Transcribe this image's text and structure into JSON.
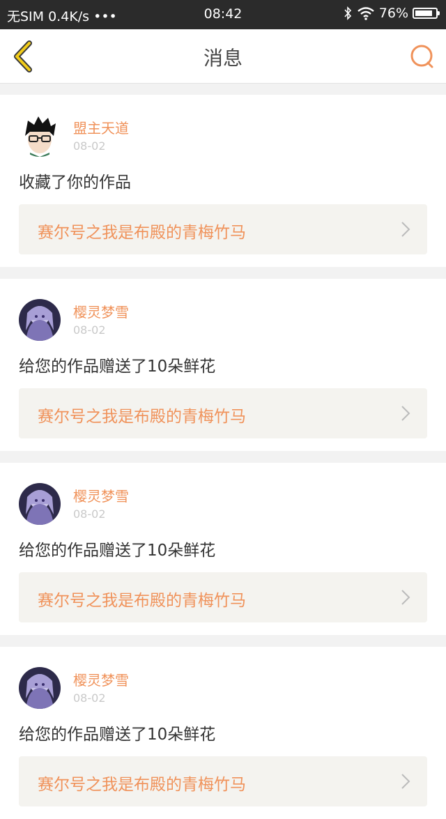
{
  "status_bar": {
    "carrier": "无SIM 0.4K/s •••",
    "time": "08:42",
    "battery": "76%"
  },
  "nav": {
    "title": "消息",
    "back_icon": "chevron-left-icon",
    "search_icon": "search-icon"
  },
  "colors": {
    "accent": "#f0925a",
    "back_icon": "#e0b800",
    "card_bg": "#ffffff",
    "link_bg": "#f4f3ef"
  },
  "messages": [
    {
      "user": "盟主天道",
      "date": "08-02",
      "text": "收藏了你的作品",
      "work": "赛尔号之我是布殿的青梅竹马"
    },
    {
      "user": "樱灵梦雪",
      "date": "08-02",
      "text": "给您的作品赠送了10朵鲜花",
      "work": "赛尔号之我是布殿的青梅竹马"
    },
    {
      "user": "樱灵梦雪",
      "date": "08-02",
      "text": "给您的作品赠送了10朵鲜花",
      "work": "赛尔号之我是布殿的青梅竹马"
    },
    {
      "user": "樱灵梦雪",
      "date": "08-02",
      "text": "给您的作品赠送了10朵鲜花",
      "work": "赛尔号之我是布殿的青梅竹马"
    }
  ]
}
